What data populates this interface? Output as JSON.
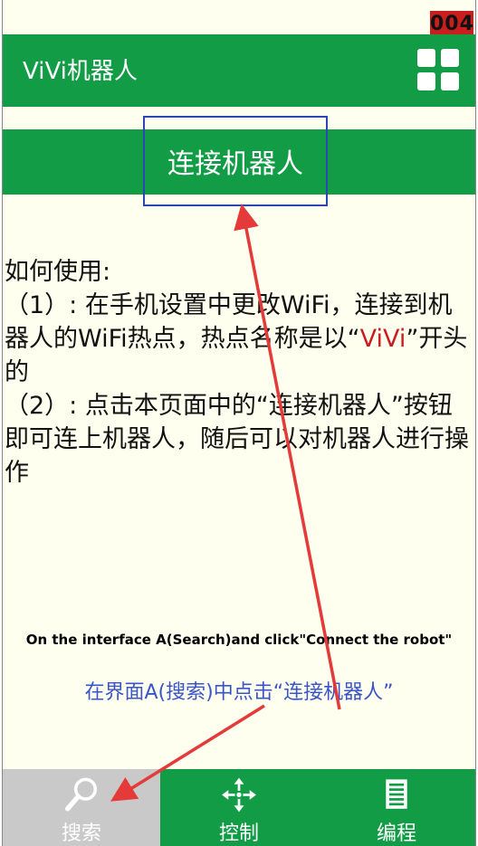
{
  "badge": "004",
  "app": {
    "title": "ViVi机器人",
    "menu_icon": "grid-icon"
  },
  "connect": {
    "label": "连接机器人"
  },
  "howto": {
    "heading": "如何使用:",
    "step1_a": "（1）: 在手机设置中更改WiFi，连接到机器人的WiFi热点，热点名称是以“",
    "step1_highlight": "ViVi",
    "step1_b": "”开头的",
    "step2": "（2）: 点击本页面中的“连接机器人”按钮即可连上机器人，随后可以对机器人进行操作"
  },
  "annotation": {
    "english": "On the interface A(Search)and click\"Connect the robot\"",
    "chinese": "在界面A(搜索)中点击“连接机器人”"
  },
  "tabs": [
    {
      "label": "搜索",
      "icon": "search-icon",
      "active": true
    },
    {
      "label": "控制",
      "icon": "move-arrows-icon",
      "active": false
    },
    {
      "label": "编程",
      "icon": "list-icon",
      "active": false
    }
  ],
  "colors": {
    "primary_green": "#129c46",
    "highlight_red": "#c81e1e",
    "annotation_blue": "#3a55c8",
    "arrow_red": "#e53a3a",
    "background": "#fffff0"
  }
}
